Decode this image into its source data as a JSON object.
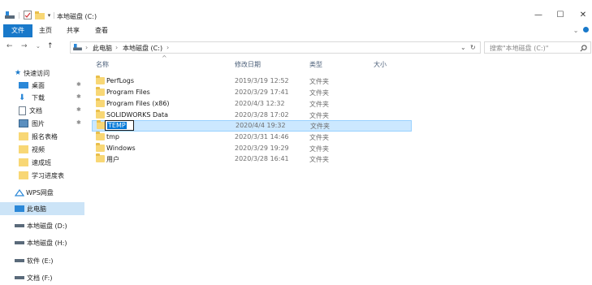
{
  "window": {
    "title": "本地磁盘 (C:)",
    "minimize": "—",
    "maximize": "☐",
    "close": "✕"
  },
  "ribbon": {
    "tabs": [
      "文件",
      "主页",
      "共享",
      "查看"
    ],
    "active_tab": "文件",
    "expand": "⌄"
  },
  "address": {
    "back": "←",
    "forward": "→",
    "recent": "⌄",
    "up": "↑",
    "crumbs": [
      "此电脑",
      "本地磁盘 (C:)"
    ],
    "separator": "›",
    "dropdown": "⌄",
    "refresh": "↻"
  },
  "search": {
    "placeholder": "搜索\"本地磁盘 (C:)\"",
    "icon": "search-icon"
  },
  "columns": {
    "name": "名称",
    "date": "修改日期",
    "type": "类型",
    "size": "大小",
    "sort_indicator": "^"
  },
  "nav": {
    "quick_access": "快速访问",
    "items": [
      {
        "label": "桌面",
        "icon": "desktop-icon",
        "pinned": true
      },
      {
        "label": "下载",
        "icon": "download-icon",
        "pinned": true
      },
      {
        "label": "文档",
        "icon": "document-icon",
        "pinned": true
      },
      {
        "label": "图片",
        "icon": "picture-icon",
        "pinned": true
      },
      {
        "label": "报名表格",
        "icon": "folder-icon",
        "pinned": false
      },
      {
        "label": "视频",
        "icon": "folder-icon",
        "pinned": false
      },
      {
        "label": "速成班",
        "icon": "folder-icon",
        "pinned": false
      },
      {
        "label": "学习进度表",
        "icon": "folder-icon",
        "pinned": false
      }
    ],
    "wps": "WPS网盘",
    "this_pc": "此电脑",
    "drives": [
      "本地磁盘 (D:)",
      "本地磁盘 (H:)",
      "软件 (E:)",
      "文档 (F:)"
    ],
    "pin_glyph": "✱"
  },
  "files": [
    {
      "name": "PerfLogs",
      "date": "2019/3/19 12:52",
      "type": "文件夹"
    },
    {
      "name": "Program Files",
      "date": "2020/3/29 17:41",
      "type": "文件夹"
    },
    {
      "name": "Program Files (x86)",
      "date": "2020/4/3 12:32",
      "type": "文件夹"
    },
    {
      "name": "SOLIDWORKS Data",
      "date": "2020/3/28 17:02",
      "type": "文件夹"
    },
    {
      "name": "TEMP",
      "date": "2020/4/4 19:32",
      "type": "文件夹",
      "renaming": true
    },
    {
      "name": "tmp",
      "date": "2020/3/31 14:46",
      "type": "文件夹"
    },
    {
      "name": "Windows",
      "date": "2020/3/29 19:29",
      "type": "文件夹"
    },
    {
      "name": "用户",
      "date": "2020/3/28 16:41",
      "type": "文件夹"
    }
  ],
  "colors": {
    "accent": "#1979ca",
    "selection": "#cce8ff",
    "folder": "#f8d775"
  }
}
